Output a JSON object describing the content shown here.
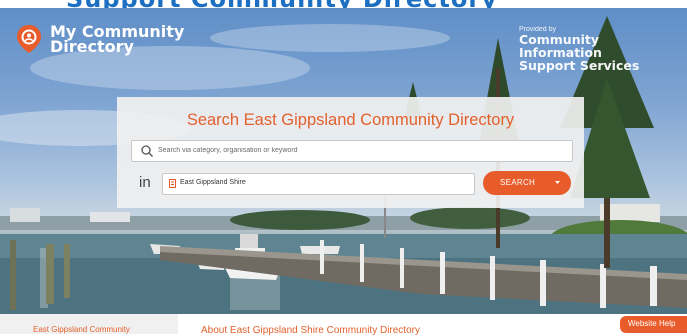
{
  "header": {
    "cut_title": "Support Community Directory",
    "logo_line1": "My Community",
    "logo_line2": "Directory",
    "provided_by": "Provided by",
    "org_line1": "Community Information",
    "org_line2": "Support Services"
  },
  "search_panel": {
    "title": "Search East Gippsland Community Directory",
    "search_placeholder": "Search via category, organisation or keyword",
    "in_label": "in",
    "location_value": "East Gippsland Shire",
    "search_button": "SEARCH"
  },
  "footer": {
    "left_tab": "East Gippsland Community",
    "about_heading": "About East Gippsland Shire Community Directory",
    "help_button": "Website Help"
  },
  "colors": {
    "accent": "#e85c2b",
    "title_orange": "#e2612d",
    "brand_blue": "#1d6fc2"
  },
  "icons": [
    "logo-pin-icon",
    "search-icon",
    "location-pin-icon",
    "chevron-down-icon"
  ]
}
